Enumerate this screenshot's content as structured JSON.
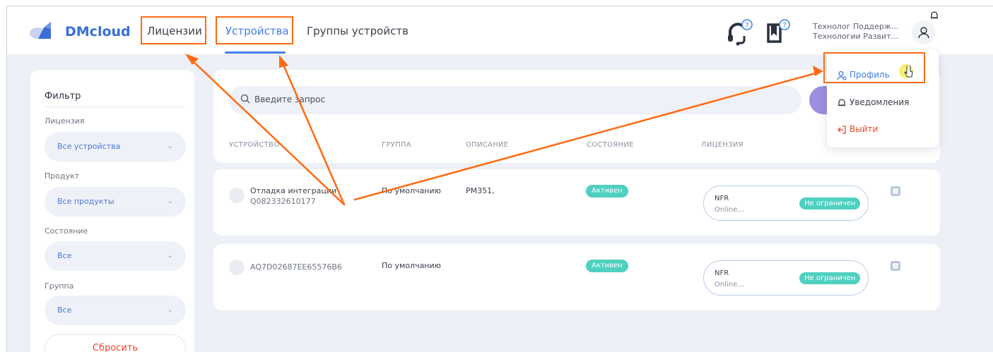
{
  "brand": {
    "name": "DMcloud"
  },
  "nav": {
    "items": [
      {
        "label": "Лицензии"
      },
      {
        "label": "Устройства"
      },
      {
        "label": "Группы устройств"
      }
    ]
  },
  "header": {
    "support_icon": "headset-question-icon",
    "docs_icon": "book-question-icon",
    "bell_icon": "bell-icon",
    "user_line1": "Технолог Поддерж...",
    "user_line2": "Технологии Развит...",
    "avatar_icon": "user-icon"
  },
  "filter": {
    "title": "Фильтр",
    "license_label": "Лицензия",
    "license_value": "Все устройства",
    "product_label": "Продукт",
    "product_value": "Все продукты",
    "state_label": "Состояние",
    "state_value": "Все",
    "group_label": "Группа",
    "group_value": "Все",
    "reset_label": "Сбросить"
  },
  "search": {
    "placeholder": "Введите запрос"
  },
  "table": {
    "headers": [
      "УСТРОЙСТВО",
      "ГРУППА",
      "ОПИСАНИЕ",
      "СОСТОЯНИЕ",
      "ЛИЦЕНЗИЯ"
    ],
    "rows": [
      {
        "device_name": "Отладка интеграции",
        "device_id": "Q082332610177",
        "group": "По умолчанию",
        "description": "PM351,",
        "state": "Активен",
        "license_name": "NFR",
        "license_sub": "Online...",
        "license_badge": "Не ограничен"
      },
      {
        "device_name": "",
        "device_id": "AQ7D02687EE65576B6",
        "group": "По умолчанию",
        "description": "",
        "state": "Активен",
        "license_name": "NFR",
        "license_sub": "Online...",
        "license_badge": "Не ограничен"
      }
    ]
  },
  "user_menu": {
    "items": [
      {
        "label": "Профиль",
        "icon": "user-settings-icon"
      },
      {
        "label": "Уведомления",
        "icon": "bell-icon"
      },
      {
        "label": "Выйти",
        "icon": "logout-icon"
      }
    ]
  },
  "colors": {
    "accent": "#3f7ee8",
    "annotation": "#ff6a13",
    "status": "#4fd0c0",
    "danger": "#e8452d"
  }
}
